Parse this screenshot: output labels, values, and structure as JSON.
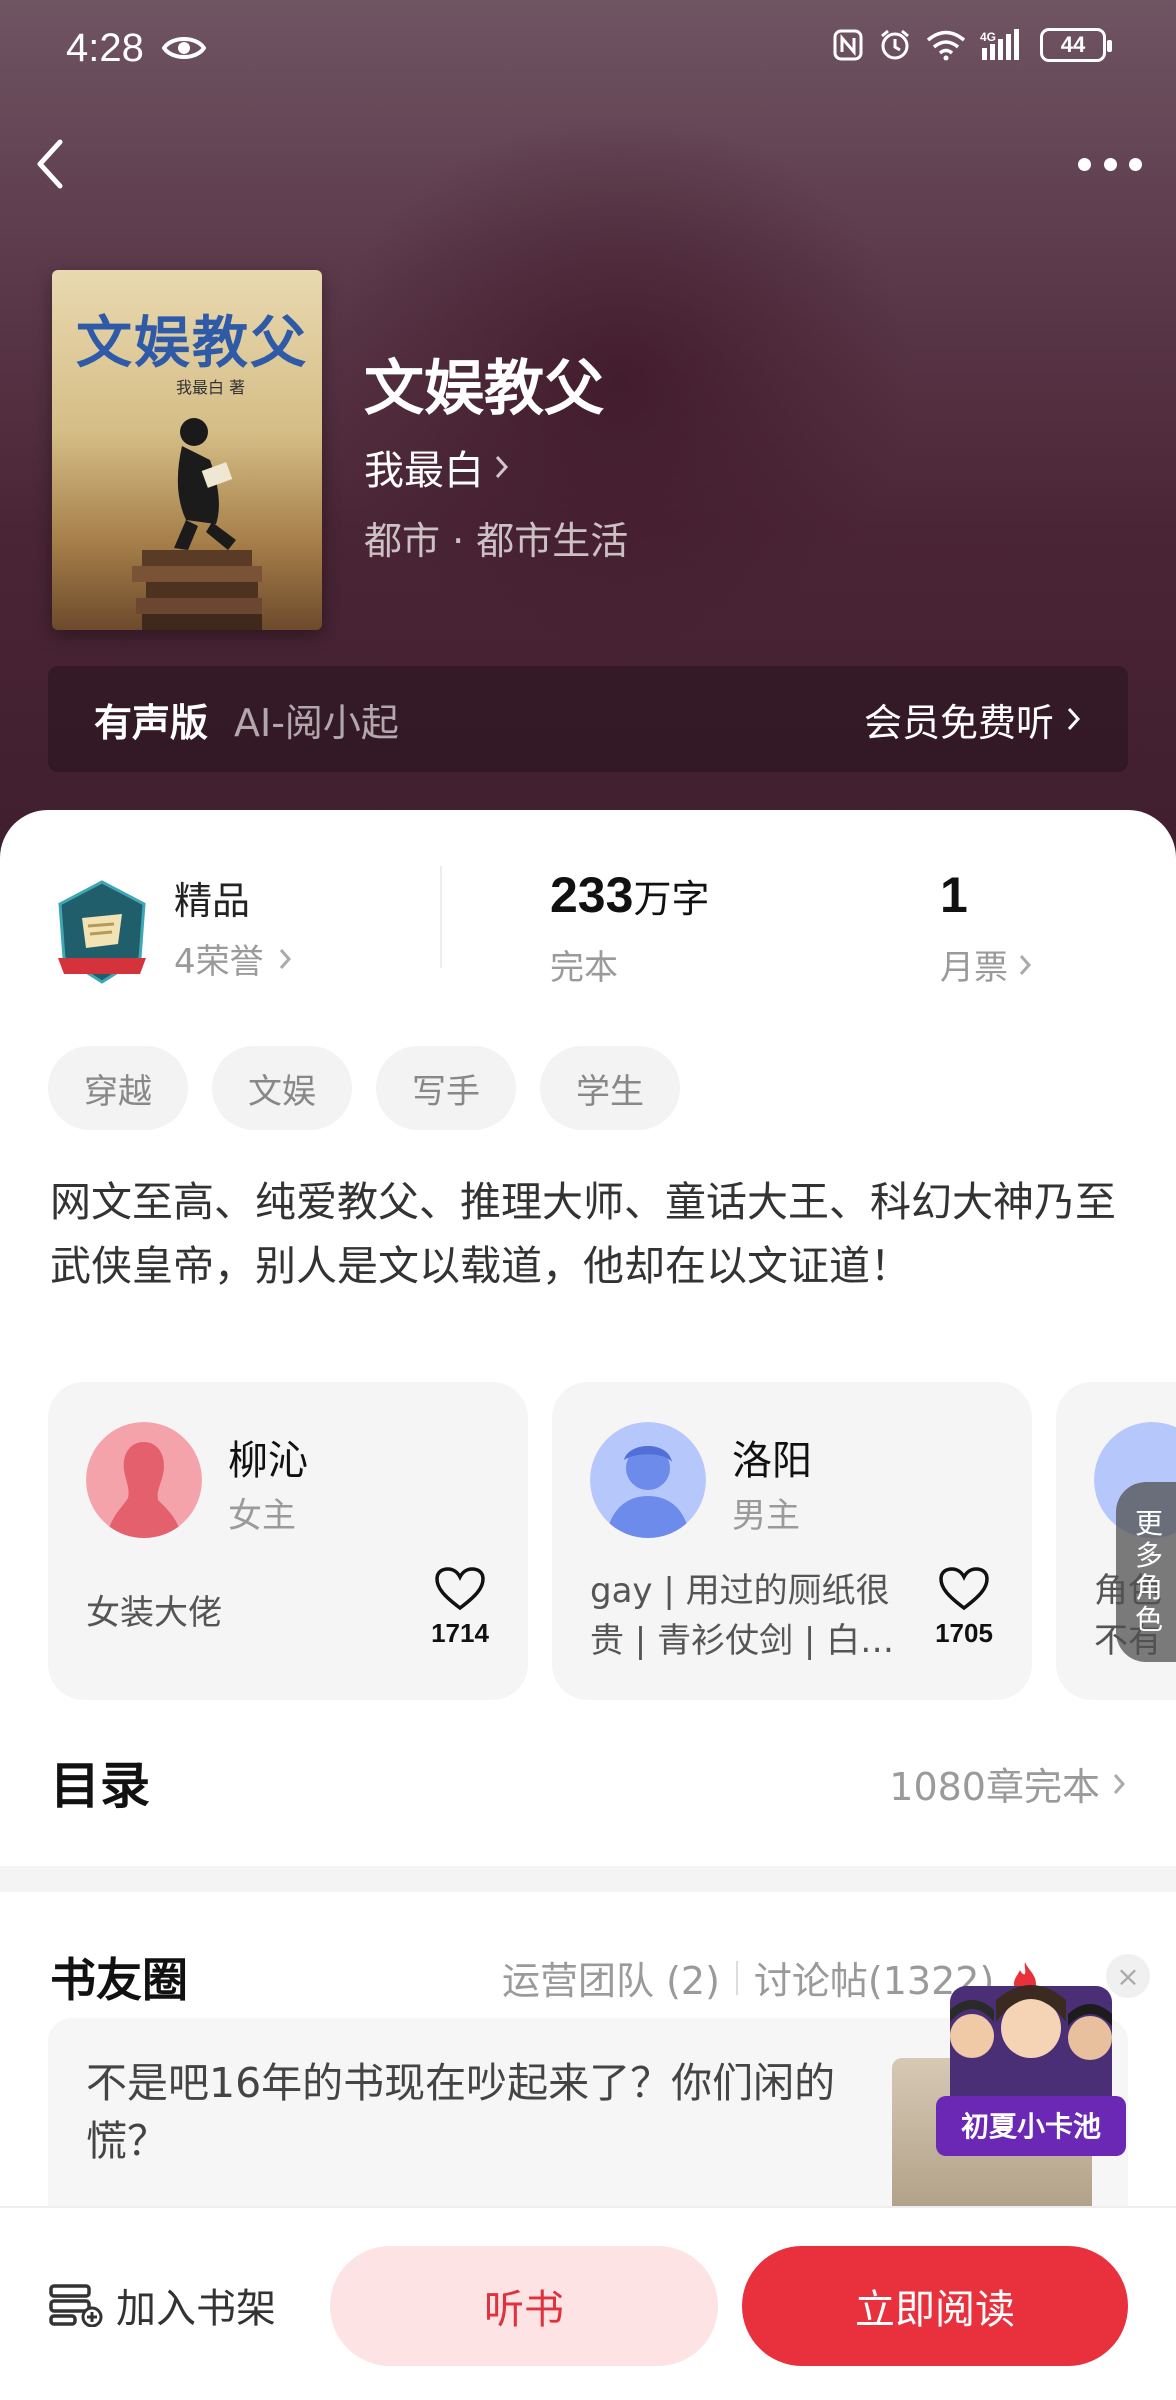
{
  "status_bar": {
    "time": "4:28",
    "battery": "44"
  },
  "book": {
    "cover_title": "文娱教父",
    "cover_author": "我最白 著",
    "title": "文娱教父",
    "author": "我最白",
    "genre": "都市 · 都市生活"
  },
  "audio": {
    "label": "有声版",
    "narrator": "AI-阅小起",
    "action": "会员免费听"
  },
  "stats": {
    "honor_title": "精品",
    "honor_count": "4荣誉",
    "words_num": "233",
    "words_unit": "万字",
    "status": "完本",
    "ticket_num": "1",
    "ticket_label": "月票"
  },
  "tags": [
    "穿越",
    "文娱",
    "写手",
    "学生"
  ],
  "intro": "网文至高、纯爱教父、推理大师、童话大王、科幻大神乃至武侠皇帝，别人是文以载道，他却在以文证道！",
  "roles": [
    {
      "name": "柳沁",
      "type": "女主",
      "desc": "女装大佬",
      "likes": "1714"
    },
    {
      "name": "洛阳",
      "type": "男主",
      "desc": "gay | 用过的厕纸很贵 | 青衫仗剑 | 白…",
      "likes": "1705"
    },
    {
      "desc": "角色不有简介"
    }
  ],
  "more_roles": "更多角色",
  "toc": {
    "title": "目录",
    "info": "1080章完本"
  },
  "circle": {
    "title": "书友圈",
    "team": "运营团队 (2)",
    "posts": "讨论帖(1322)",
    "post_text": "不是吧16年的书现在吵起来了？你们闲的慌？"
  },
  "widget": {
    "label": "初夏小卡池"
  },
  "bottom": {
    "shelf": "加入书架",
    "listen": "听书",
    "read": "立即阅读"
  },
  "colors": {
    "accent": "#e8313d",
    "accent_soft": "#fde3e4",
    "hero": "#4a2535"
  }
}
